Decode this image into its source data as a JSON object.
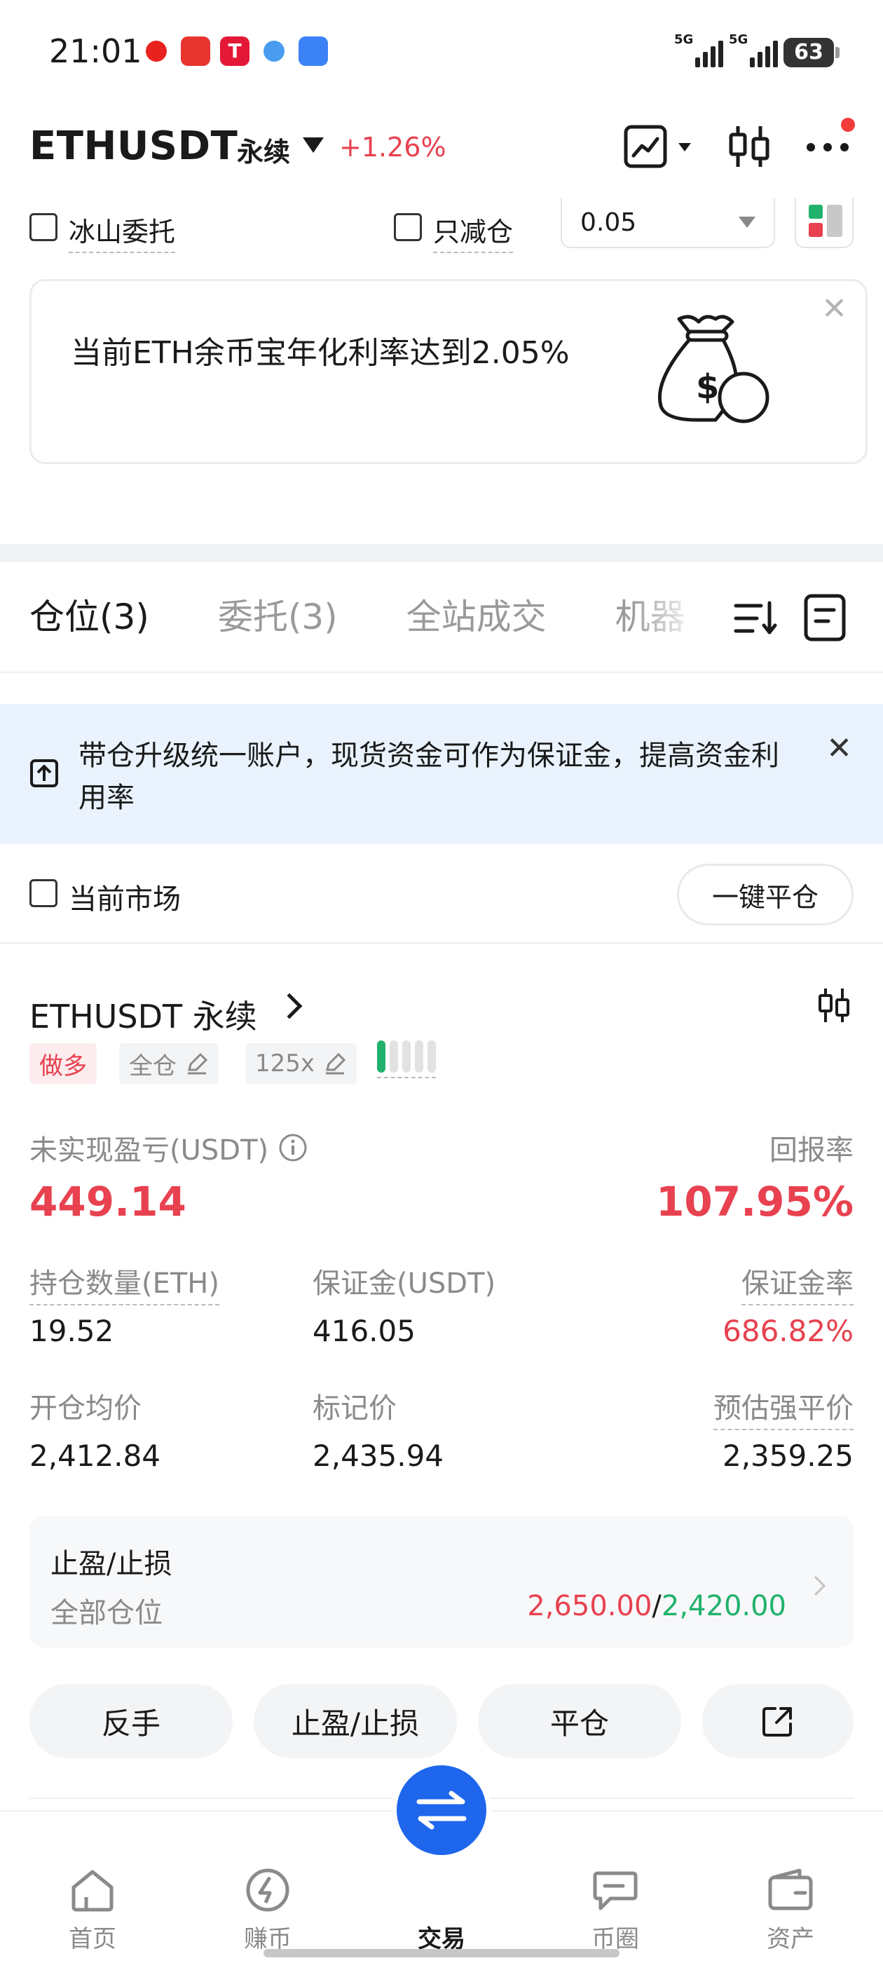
{
  "status_bar": {
    "time": "21:01",
    "signal_1": "5G",
    "signal_2": "5G",
    "battery": "63"
  },
  "header": {
    "symbol": "ETHUSDT",
    "contract_type": "永续",
    "change": "+1.26%",
    "colors": {
      "up_red": "#e8414f",
      "down_green": "#20b26c"
    }
  },
  "options": {
    "iceberg_label": "冰山委托",
    "reduce_only_label": "只减仓",
    "quantity_step": "0.05"
  },
  "promo": {
    "text": "当前ETH余币宝年化利率达到2.05%",
    "close_icon": "close-icon",
    "illustration": "money-bag-icon"
  },
  "tabs": [
    {
      "label": "仓位(3)",
      "active": true
    },
    {
      "label": "委托(3)",
      "active": false
    },
    {
      "label": "全站成交",
      "active": false
    },
    {
      "label": "机器",
      "active": false
    }
  ],
  "info_bar": {
    "text": "带仓升级统一账户，现货资金可作为保证金，提高资金利用率"
  },
  "market_filter": {
    "label": "当前市场",
    "close_all_button": "一键平仓"
  },
  "position": {
    "title": "ETHUSDT 永续",
    "side_tag": "做多",
    "margin_mode": "全仓",
    "leverage": "125x",
    "risk_level": 1,
    "risk_level_max": 5,
    "upnl_label": "未实现盈亏(USDT)",
    "upnl_value": "449.14",
    "roe_label": "回报率",
    "roe_value": "107.95%",
    "size_label": "持仓数量(ETH)",
    "size_value": "19.52",
    "margin_label": "保证金(USDT)",
    "margin_value": "416.05",
    "margin_ratio_label": "保证金率",
    "margin_ratio_value": "686.82%",
    "entry_label": "开仓均价",
    "entry_value": "2,412.84",
    "mark_label": "标记价",
    "mark_value": "2,435.94",
    "liq_label": "预估强平价",
    "liq_value": "2,359.25",
    "tpsl_title": "止盈/止损",
    "tpsl_scope": "全部仓位",
    "tp_price": "2,650.00",
    "tpsl_separator": "/",
    "sl_price": "2,420.00",
    "actions": {
      "reverse": "反手",
      "tpsl": "止盈/止损",
      "close": "平仓"
    }
  },
  "bottom_nav": [
    {
      "label": "首页",
      "icon": "home-icon"
    },
    {
      "label": "赚币",
      "icon": "earn-icon"
    },
    {
      "label": "交易",
      "icon": "trade-icon",
      "active": true
    },
    {
      "label": "币圈",
      "icon": "community-icon"
    },
    {
      "label": "资产",
      "icon": "wallet-icon"
    }
  ]
}
